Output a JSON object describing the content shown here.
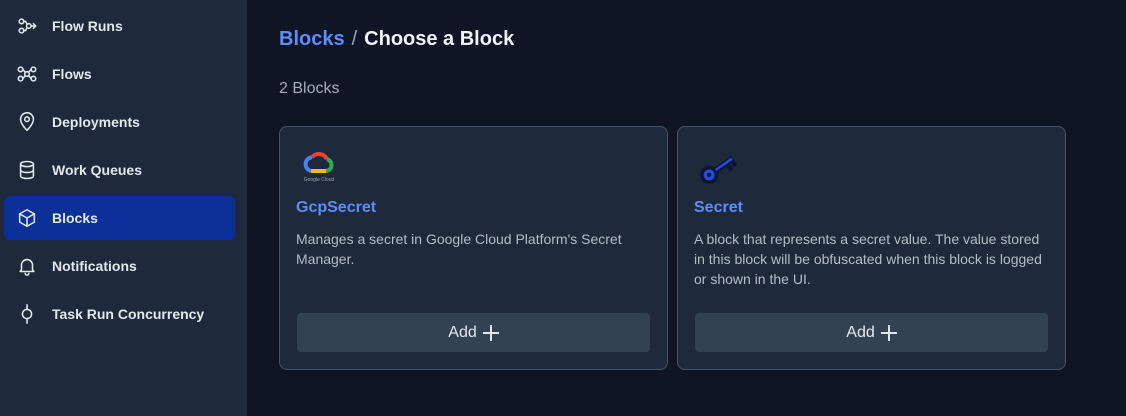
{
  "sidebar": {
    "items": [
      {
        "label": "Flow Runs",
        "icon": "flow-runs-icon",
        "active": false
      },
      {
        "label": "Flows",
        "icon": "flows-icon",
        "active": false
      },
      {
        "label": "Deployments",
        "icon": "location-pin-icon",
        "active": false
      },
      {
        "label": "Work Queues",
        "icon": "database-icon",
        "active": false
      },
      {
        "label": "Blocks",
        "icon": "cube-icon",
        "active": true
      },
      {
        "label": "Notifications",
        "icon": "bell-icon",
        "active": false
      },
      {
        "label": "Task Run Concurrency",
        "icon": "concurrency-icon",
        "active": false
      }
    ]
  },
  "breadcrumb": {
    "parent": "Blocks",
    "separator": "/",
    "current": "Choose a Block"
  },
  "count_label": "2 Blocks",
  "cards": [
    {
      "title": "GcpSecret",
      "logo": "google-cloud-logo",
      "logo_caption": "Google Cloud",
      "description": "Manages a secret in Google Cloud Platform's Secret Manager.",
      "button_label": "Add"
    },
    {
      "title": "Secret",
      "logo": "key-logo",
      "description": "A block that represents a secret value. The value stored in this block will be obfuscated when this block is logged or shown in the UI.",
      "button_label": "Add"
    }
  ],
  "colors": {
    "sidebar_bg": "#1e293b",
    "active_bg": "#0b309a",
    "main_bg": "#0f1525",
    "link": "#5b8ef8"
  }
}
